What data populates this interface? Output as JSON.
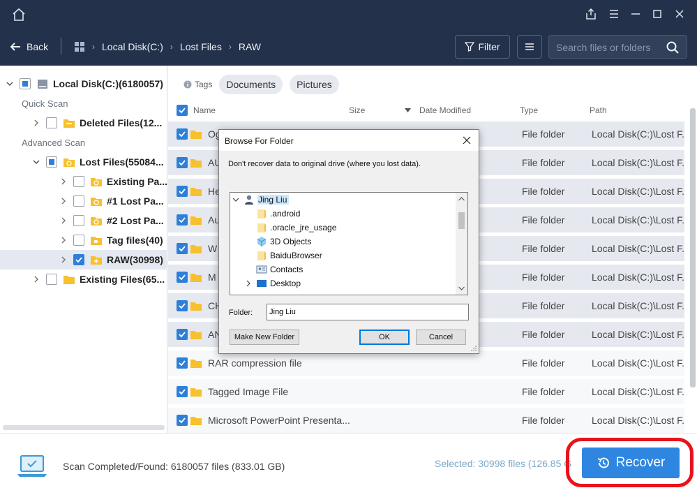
{
  "colors": {
    "accent": "#2f86e1",
    "header_bg": "#24314a",
    "highlight_ring": "#e8131b",
    "folder": "#f6c02e"
  },
  "navbar": {
    "back_label": "Back",
    "breadcrumbs": [
      "Local Disk(C:)",
      "Lost Files",
      "RAW"
    ],
    "filter_label": "Filter",
    "search_placeholder": "Search files or folders"
  },
  "sidebar": {
    "root_label": "Local Disk(C:)(6180057)",
    "quick_scan_label": "Quick Scan",
    "deleted_files_label": "Deleted Files(12...",
    "advanced_scan_label": "Advanced Scan",
    "lost_files_label": "Lost Files(55084...",
    "existing_partition_label": "Existing Pa...",
    "lost_partition_1_label": "#1 Lost Pa...",
    "lost_partition_2_label": "#2 Lost Pa...",
    "tag_files_label": "Tag files(40)",
    "raw_label": "RAW(30998)",
    "existing_files_label": "Existing Files(65..."
  },
  "tags": {
    "label": "Tags",
    "items": [
      "Documents",
      "Pictures"
    ]
  },
  "table": {
    "headers": {
      "name": "Name",
      "size": "Size",
      "date": "Date Modified",
      "type": "Type",
      "path": "Path"
    },
    "rows": [
      {
        "name": "Og",
        "type": "File folder",
        "path": "Local Disk(C:)\\Lost F..."
      },
      {
        "name": "AU",
        "type": "File folder",
        "path": "Local Disk(C:)\\Lost F..."
      },
      {
        "name": "He",
        "type": "File folder",
        "path": "Local Disk(C:)\\Lost F..."
      },
      {
        "name": "Au",
        "type": "File folder",
        "path": "Local Disk(C:)\\Lost F..."
      },
      {
        "name": "W",
        "type": "File folder",
        "path": "Local Disk(C:)\\Lost F..."
      },
      {
        "name": "M",
        "type": "File folder",
        "path": "Local Disk(C:)\\Lost F..."
      },
      {
        "name": "CH",
        "type": "File folder",
        "path": "Local Disk(C:)\\Lost F..."
      },
      {
        "name": "AN",
        "type": "File folder",
        "path": "Local Disk(C:)\\Lost F..."
      },
      {
        "name": "RAR compression file",
        "type": "File folder",
        "path": "Local Disk(C:)\\Lost F..."
      },
      {
        "name": "Tagged Image File",
        "type": "File folder",
        "path": "Local Disk(C:)\\Lost F..."
      },
      {
        "name": "Microsoft PowerPoint Presenta...",
        "type": "File folder",
        "path": "Local Disk(C:)\\Lost F..."
      }
    ]
  },
  "footer": {
    "status": "Scan Completed/Found: 6180057 files (833.01 GB)",
    "selected": "Selected: 30998 files (126.85 G",
    "recover_label": "Recover"
  },
  "dialog": {
    "title": "Browse For Folder",
    "message": "Don't recover data to original drive (where you lost data).",
    "tree": {
      "root": "Jing Liu",
      "items": [
        ".android",
        ".oracle_jre_usage",
        "3D Objects",
        "BaiduBrowser",
        "Contacts",
        "Desktop"
      ]
    },
    "folder_label": "Folder:",
    "folder_value": "Jing Liu",
    "make_folder_label": "Make New Folder",
    "ok_label": "OK",
    "cancel_label": "Cancel"
  }
}
